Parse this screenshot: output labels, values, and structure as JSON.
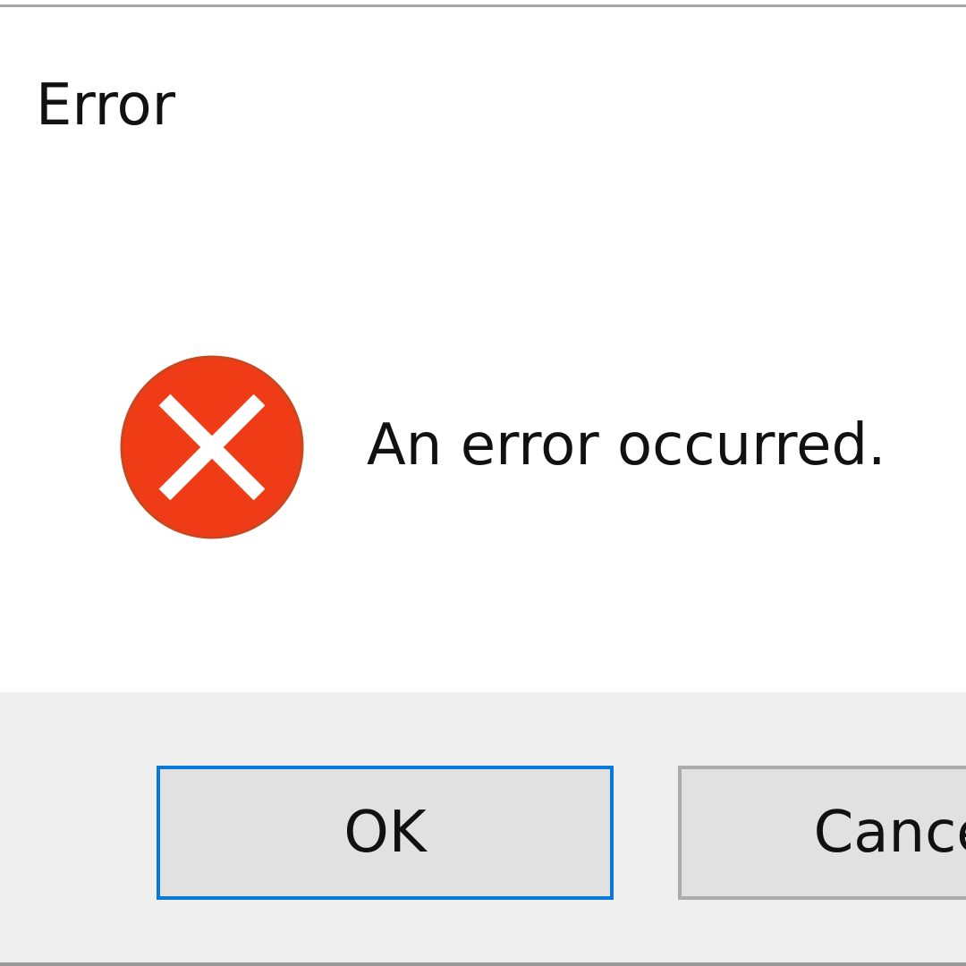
{
  "dialog": {
    "title": "Error",
    "message": "An error occurred.",
    "icon": "error-icon"
  },
  "buttons": {
    "ok_label": "OK",
    "cancel_label": "Cancel"
  },
  "colors": {
    "error_red": "#ef3c16",
    "focus_blue": "#0a78d7",
    "button_face": "#e1e1e1",
    "footer_bg": "#efefef"
  }
}
